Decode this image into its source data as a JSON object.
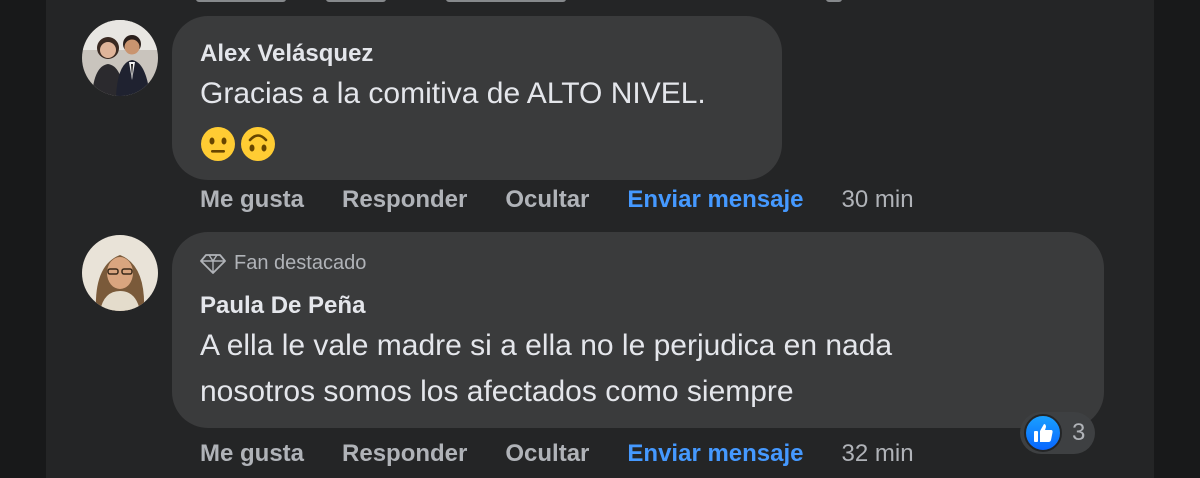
{
  "comments": [
    {
      "author": "Alex Velásquez",
      "text_lines": [
        "Gracias a la comitiva de ALTO NIVEL."
      ],
      "emojis": [
        "neutral-face",
        "upside-down-face"
      ],
      "actions": {
        "like": "Me gusta",
        "reply": "Responder",
        "hide": "Ocultar",
        "message": "Enviar mensaje",
        "time": "30 min"
      }
    },
    {
      "badge": "Fan destacado",
      "author": "Paula De Peña",
      "text_lines": [
        "A ella le vale madre si a ella no le perjudica en nada",
        "nosotros somos los afectados como siempre"
      ],
      "actions": {
        "like": "Me gusta",
        "reply": "Responder",
        "hide": "Ocultar",
        "message": "Enviar mensaje",
        "time": "32 min"
      },
      "reactions": {
        "icon": "like-icon",
        "count": "3"
      }
    }
  ],
  "colors": {
    "page_bg": "#18191a",
    "panel_bg": "#242526",
    "bubble_bg": "#3a3b3c",
    "primary_text": "#e4e6eb",
    "secondary_text": "#b0b3b8",
    "link_blue": "#4599ff",
    "like_blue": "#0866ff"
  }
}
